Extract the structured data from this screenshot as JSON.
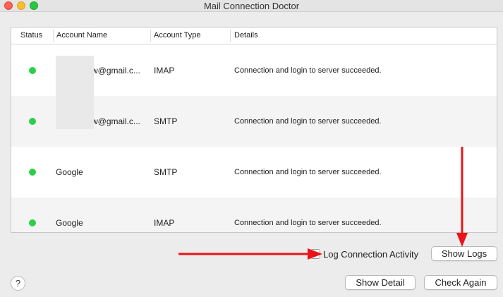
{
  "window": {
    "title": "Mail Connection Doctor"
  },
  "table": {
    "columns": [
      "Status",
      "Account Name",
      "Account Type",
      "Details"
    ],
    "rows": [
      {
        "status": "connected",
        "account": "w@gmail.c...",
        "type": "IMAP",
        "details": "Connection and login to server succeeded."
      },
      {
        "status": "connected",
        "account": "w@gmail.c...",
        "type": "SMTP",
        "details": "Connection and login to server succeeded."
      },
      {
        "status": "connected",
        "account": "Google",
        "type": "SMTP",
        "details": "Connection and login to server succeeded."
      },
      {
        "status": "connected",
        "account": "Google",
        "type": "IMAP",
        "details": "Connection and login to server succeeded."
      }
    ]
  },
  "log_connection": {
    "label": "Log Connection Activity",
    "checked": false
  },
  "buttons": {
    "show_logs": "Show Logs",
    "show_detail": "Show Detail",
    "check_again": "Check Again",
    "help": "?"
  },
  "colors": {
    "status_ok": "#2ccf4a",
    "annotation_arrow": "#e8141a"
  }
}
